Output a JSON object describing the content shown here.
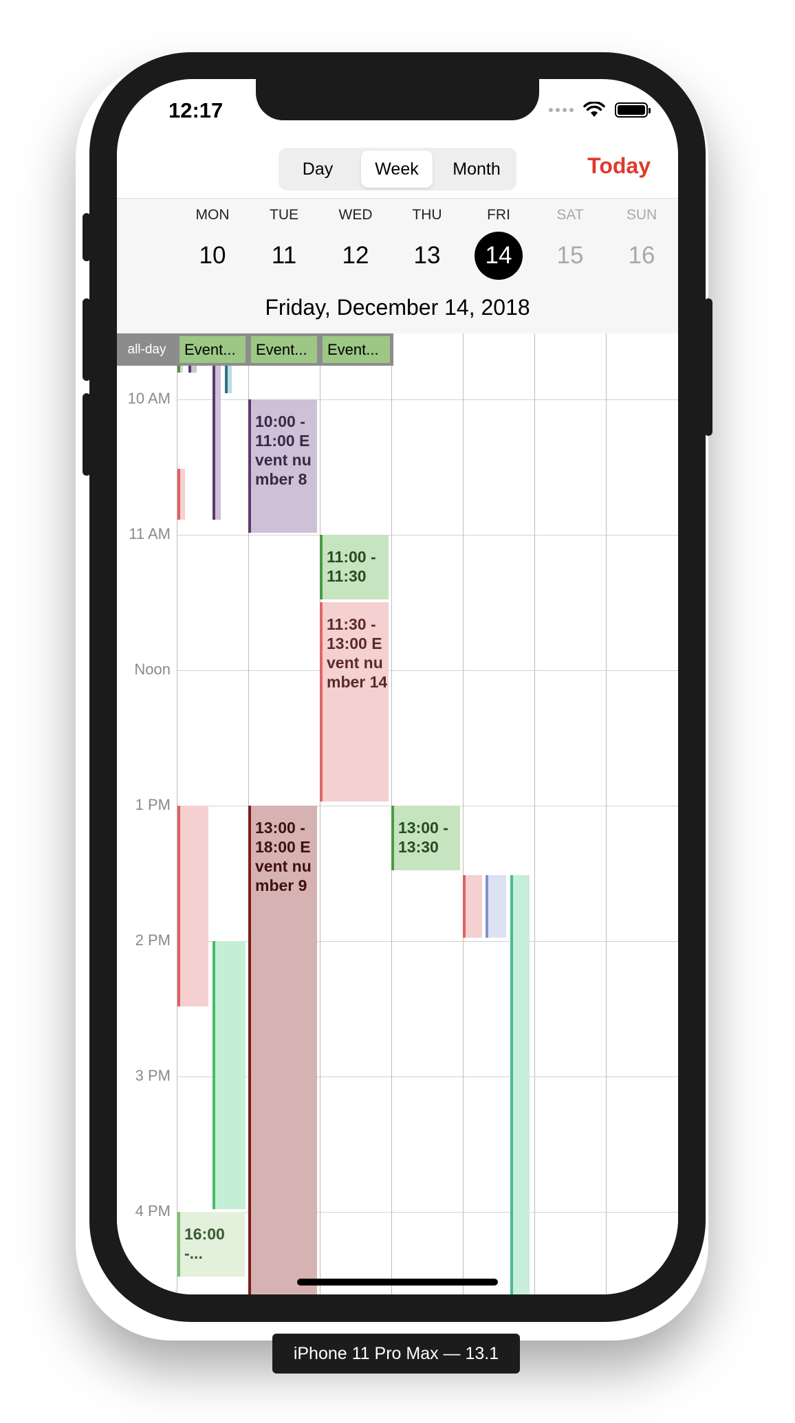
{
  "status_bar": {
    "time": "12:17"
  },
  "view_switcher": {
    "day": "Day",
    "week": "Week",
    "month": "Month",
    "selected": "Week"
  },
  "today_button": "Today",
  "week": {
    "days": [
      {
        "weekday": "MON",
        "date": "10"
      },
      {
        "weekday": "TUE",
        "date": "11"
      },
      {
        "weekday": "WED",
        "date": "12"
      },
      {
        "weekday": "THU",
        "date": "13"
      },
      {
        "weekday": "FRI",
        "date": "14"
      },
      {
        "weekday": "SAT",
        "date": "15"
      },
      {
        "weekday": "SUN",
        "date": "16"
      }
    ],
    "selected_date_text": "Friday, December 14, 2018"
  },
  "all_day": {
    "label": "all-day",
    "events": [
      {
        "title": "Event..."
      },
      {
        "title": "Event..."
      },
      {
        "title": "Event..."
      }
    ]
  },
  "hours": [
    "10 AM",
    "11 AM",
    "Noon",
    "1 PM",
    "2 PM",
    "3 PM",
    "4 PM"
  ],
  "events": [
    {
      "title": "10:00 - 11:00 Event number 8"
    },
    {
      "title": "11:00 - 11:30"
    },
    {
      "title": "11:30 - 13:00 Event number 14"
    },
    {
      "title": "13:00 - 18:00 Event number 9"
    },
    {
      "title": "13:00 - 13:30"
    },
    {
      "title": "16:00 -..."
    }
  ],
  "colors": {
    "accent_red": "#e0392b",
    "allday_green": "#9dc785",
    "purple_event": "#cec0d6",
    "green_event": "#c6e4c0",
    "pink_event": "#f4d0d0",
    "maroon_event": "#d6b2b2",
    "mint_event": "#c4efd6",
    "teal_event": "#c6eedb",
    "light_green_event": "#e2f0dc",
    "lavender_event": "#dde2f2"
  },
  "device": {
    "label": "iPhone 11 Pro Max — 13.1"
  }
}
